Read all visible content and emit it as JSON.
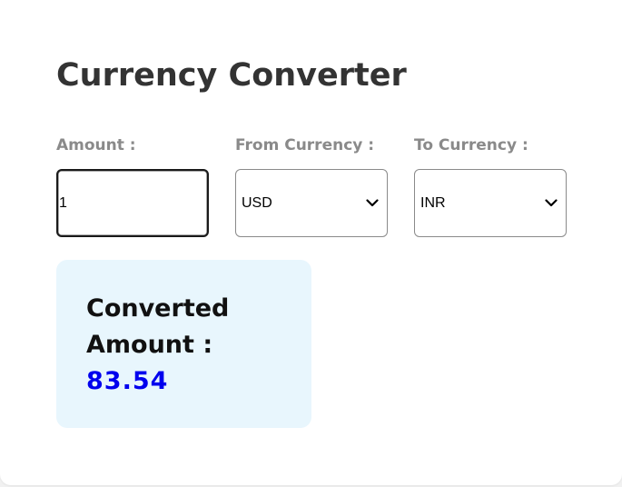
{
  "app": {
    "title": "Currency Converter"
  },
  "form": {
    "amount": {
      "label": "Amount :",
      "value": "1"
    },
    "from_currency": {
      "label": "From Currency :",
      "selected": "USD"
    },
    "to_currency": {
      "label": "To Currency :",
      "selected": "INR"
    }
  },
  "result": {
    "label": "Converted Amount :",
    "value": "83.54"
  },
  "colors": {
    "accent": "#0000ee",
    "result_background": "#e8f6fd",
    "label_gray": "#8a8a8a"
  },
  "icons": {
    "dropdown": "chevron-down-icon"
  }
}
